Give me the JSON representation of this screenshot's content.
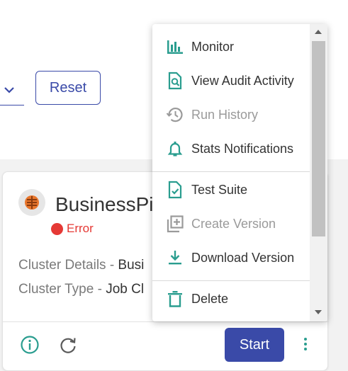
{
  "filters": {
    "reset_label": "Reset"
  },
  "card": {
    "title": "BusinessPi",
    "status": "Error",
    "cluster_details_label": "Cluster Details - ",
    "cluster_details_value": "Busi",
    "cluster_type_label": "Cluster Type - ",
    "cluster_type_value": "Job Cl",
    "start_label": "Start"
  },
  "menu": {
    "items": [
      {
        "label": "Monitor",
        "icon": "bar-chart-icon",
        "enabled": true
      },
      {
        "label": "View Audit Activity",
        "icon": "document-search-icon",
        "enabled": true
      },
      {
        "label": "Run History",
        "icon": "history-icon",
        "enabled": false
      },
      {
        "label": "Stats Notifications",
        "icon": "bell-icon",
        "enabled": true
      },
      {
        "label": "Test Suite",
        "icon": "document-check-icon",
        "enabled": true
      },
      {
        "label": "Create Version",
        "icon": "add-copy-icon",
        "enabled": false
      },
      {
        "label": "Download Version",
        "icon": "download-icon",
        "enabled": true
      },
      {
        "label": "Delete",
        "icon": "trash-icon",
        "enabled": true
      }
    ]
  },
  "colors": {
    "accent_teal": "#2a9d8f",
    "primary_blue": "#3a4aa8",
    "error_red": "#e53935",
    "disabled_grey": "#9a9a9a"
  }
}
